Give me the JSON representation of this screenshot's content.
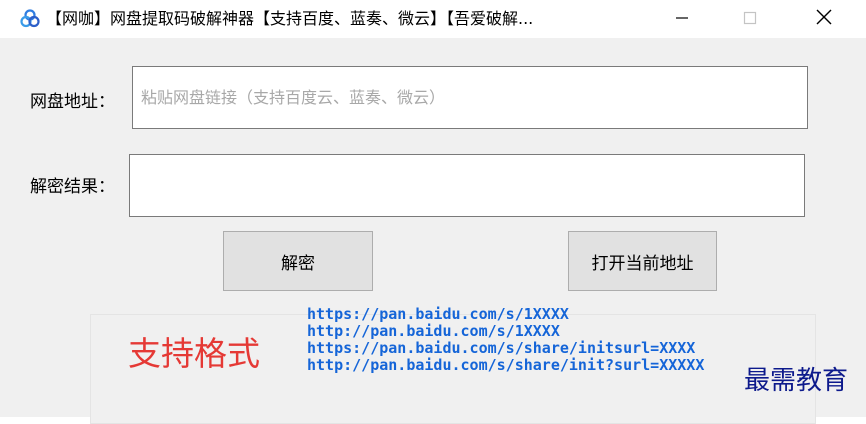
{
  "window": {
    "title": "【网咖】网盘提取码破解神器【支持百度、蓝奏、微云】【吾爱破解...",
    "app_icon": "app-logo-icon",
    "controls": {
      "minimize": "minimize-icon",
      "maximize": "maximize-icon",
      "close": "close-icon"
    }
  },
  "form": {
    "url_label": "网盘地址：",
    "url_value": "",
    "url_placeholder": "粘贴网盘链接（支持百度云、蓝奏、微云）",
    "result_label": "解密结果：",
    "result_value": ""
  },
  "buttons": {
    "decrypt_label": "解密",
    "open_label": "打开当前地址"
  },
  "formats": {
    "title": "支持格式",
    "items": [
      "https://pan.baidu.com/s/1XXXX",
      "http://pan.baidu.com/s/1XXXX",
      "https://pan.baidu.com/s/share/initsurl=XXXX",
      "http://pan.baidu.com/s/share/init?surl=XXXXX"
    ]
  },
  "watermark": {
    "text": "最需教育"
  },
  "colors": {
    "formats_title": "#e53935",
    "format_links": "#1565d8",
    "watermark": "#0d1a8c"
  }
}
